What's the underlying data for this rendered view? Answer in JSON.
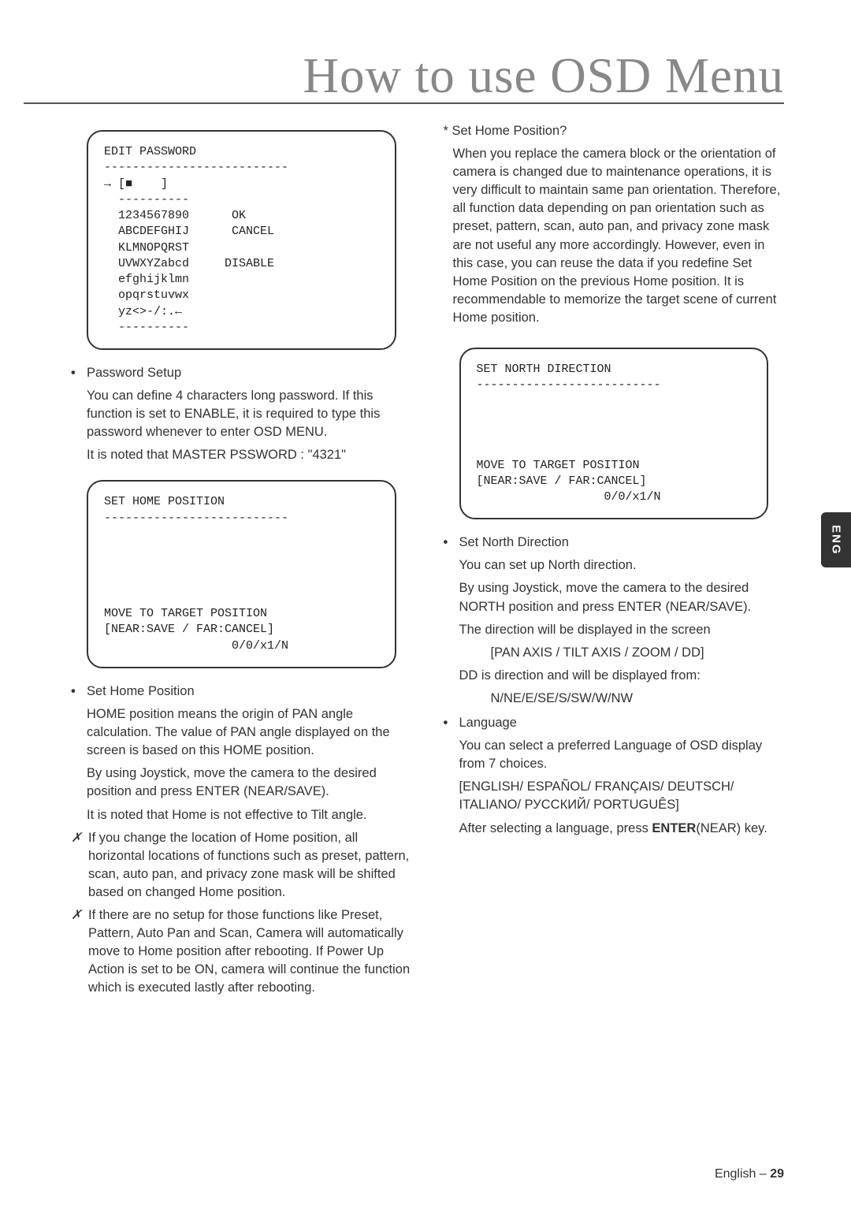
{
  "title": "How to use OSD Menu",
  "sideTab": "ENG",
  "footer": {
    "label": "English – ",
    "page": "29"
  },
  "left": {
    "osd1": "EDIT PASSWORD\n--------------------------\n→ [■    ]\n  ----------\n  1234567890      OK\n  ABCDEFGHIJ      CANCEL\n  KLMNOPQRST\n  UVWXYZabcd     DISABLE\n  efghijklmn\n  opqrstuvwx\n  yz<>-/:.←\n  ----------",
    "b1_title": "Password Setup",
    "b1_p1": "You can define 4 characters long password. If this function is set to ENABLE, it is required to type this password whenever to enter OSD MENU.",
    "b1_p2": "It is noted that MASTER PSSWORD : \"4321\"",
    "osd2": "SET HOME POSITION\n--------------------------\n\n\n\n\n\nMOVE TO TARGET POSITION\n[NEAR:SAVE / FAR:CANCEL]\n                  0/0/x1/N",
    "b2_title": "Set Home Position",
    "b2_p1": "HOME position means the origin of PAN angle calculation. The value of PAN angle displayed on the screen is based on this HOME position.",
    "b2_p2": "By using Joystick, move the camera to the desired position and press ENTER (NEAR/SAVE).",
    "b2_p3": "It is noted that Home is not effective to Tilt angle.",
    "chk1": "If you change the location of Home position, all horizontal locations of functions such as preset, pattern, scan, auto pan, and privacy zone mask will be shifted based on changed Home position.",
    "chk2": "If there are no setup for those functions like Preset, Pattern, Auto Pan and Scan, Camera will automatically move to Home position after rebooting. If Power Up Action is set to be ON, camera will continue the function which is executed lastly after rebooting."
  },
  "right": {
    "star_title": "* Set Home Position?",
    "star_body": "When you replace the camera block or the orientation of camera is changed due to maintenance operations, it is very difficult to maintain same pan orientation. Therefore, all function data depending on pan orientation such as preset, pattern, scan, auto pan, and privacy zone mask are not useful any more accordingly. However, even in this case, you can reuse the data if you redefine Set Home Position on the previous Home position. It is recommendable to memorize the target scene of current Home position.",
    "osd3": "SET NORTH DIRECTION\n--------------------------\n\n\n\n\nMOVE TO TARGET POSITION\n[NEAR:SAVE / FAR:CANCEL]\n                  0/0/x1/N",
    "b3_title": "Set North Direction",
    "b3_p1": "You can set up North direction.",
    "b3_p2": "By using Joystick, move the camera to the desired NORTH position and press ENTER (NEAR/SAVE).",
    "b3_p3": "The direction will be displayed in the screen",
    "b3_p3a": "[PAN AXIS / TILT AXIS / ZOOM / DD]",
    "b3_p4": "DD is direction and will be displayed from:",
    "b3_p4a": "N/NE/E/SE/S/SW/W/NW",
    "b4_title": "Language",
    "b4_p1": "You can select a preferred Language of OSD display from 7 choices.",
    "b4_p2": "[ENGLISH/ ESPAÑOL/ FRANÇAIS/ DEUTSCH/ ITALIANO/ РУССКИЙ/ PORTUGUÊS]",
    "b4_p3_a": "After selecting a language, press ",
    "b4_p3_b": "ENTER",
    "b4_p3_c": "(NEAR) key."
  }
}
